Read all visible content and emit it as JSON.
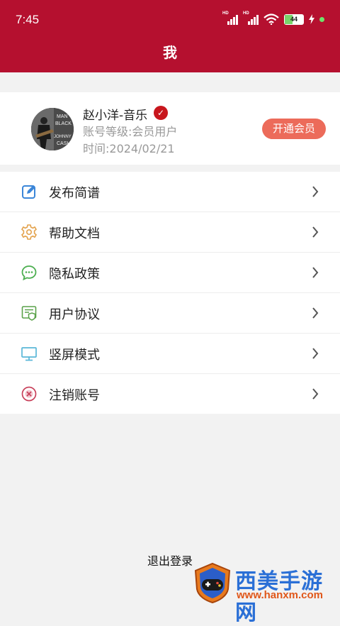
{
  "status_bar": {
    "time": "7:45",
    "sim1_label": "HD",
    "sim2_label": "HD",
    "battery_level": "44",
    "battery_fraction": 0.44
  },
  "header": {
    "title": "我"
  },
  "profile": {
    "name": "赵小洋-音乐",
    "level": "账号等级:会员用户",
    "time": "时间:2024/02/21",
    "vip_button": "开通会员",
    "avatar_text": [
      "MAN",
      "BLACK",
      "JOHNNY",
      "CASH"
    ]
  },
  "menu": {
    "items": [
      {
        "label": "发布简谱",
        "icon": "edit-icon",
        "color": "#3b86d8"
      },
      {
        "label": "帮助文档",
        "icon": "gear-icon",
        "color": "#e3a24c"
      },
      {
        "label": "隐私政策",
        "icon": "chat-icon",
        "color": "#4caf50"
      },
      {
        "label": "用户协议",
        "icon": "document-shield-icon",
        "color": "#5aa24a"
      },
      {
        "label": "竖屏模式",
        "icon": "monitor-icon",
        "color": "#5ab7d8"
      },
      {
        "label": "注销账号",
        "icon": "cancel-circle-icon",
        "color": "#c8405a"
      }
    ]
  },
  "logout_label": "退出登录",
  "watermark": {
    "title": "西美手游网",
    "url": "www.hanxm.com"
  },
  "colors": {
    "brand": "#b5102f",
    "vip": "#ec6b5a"
  }
}
